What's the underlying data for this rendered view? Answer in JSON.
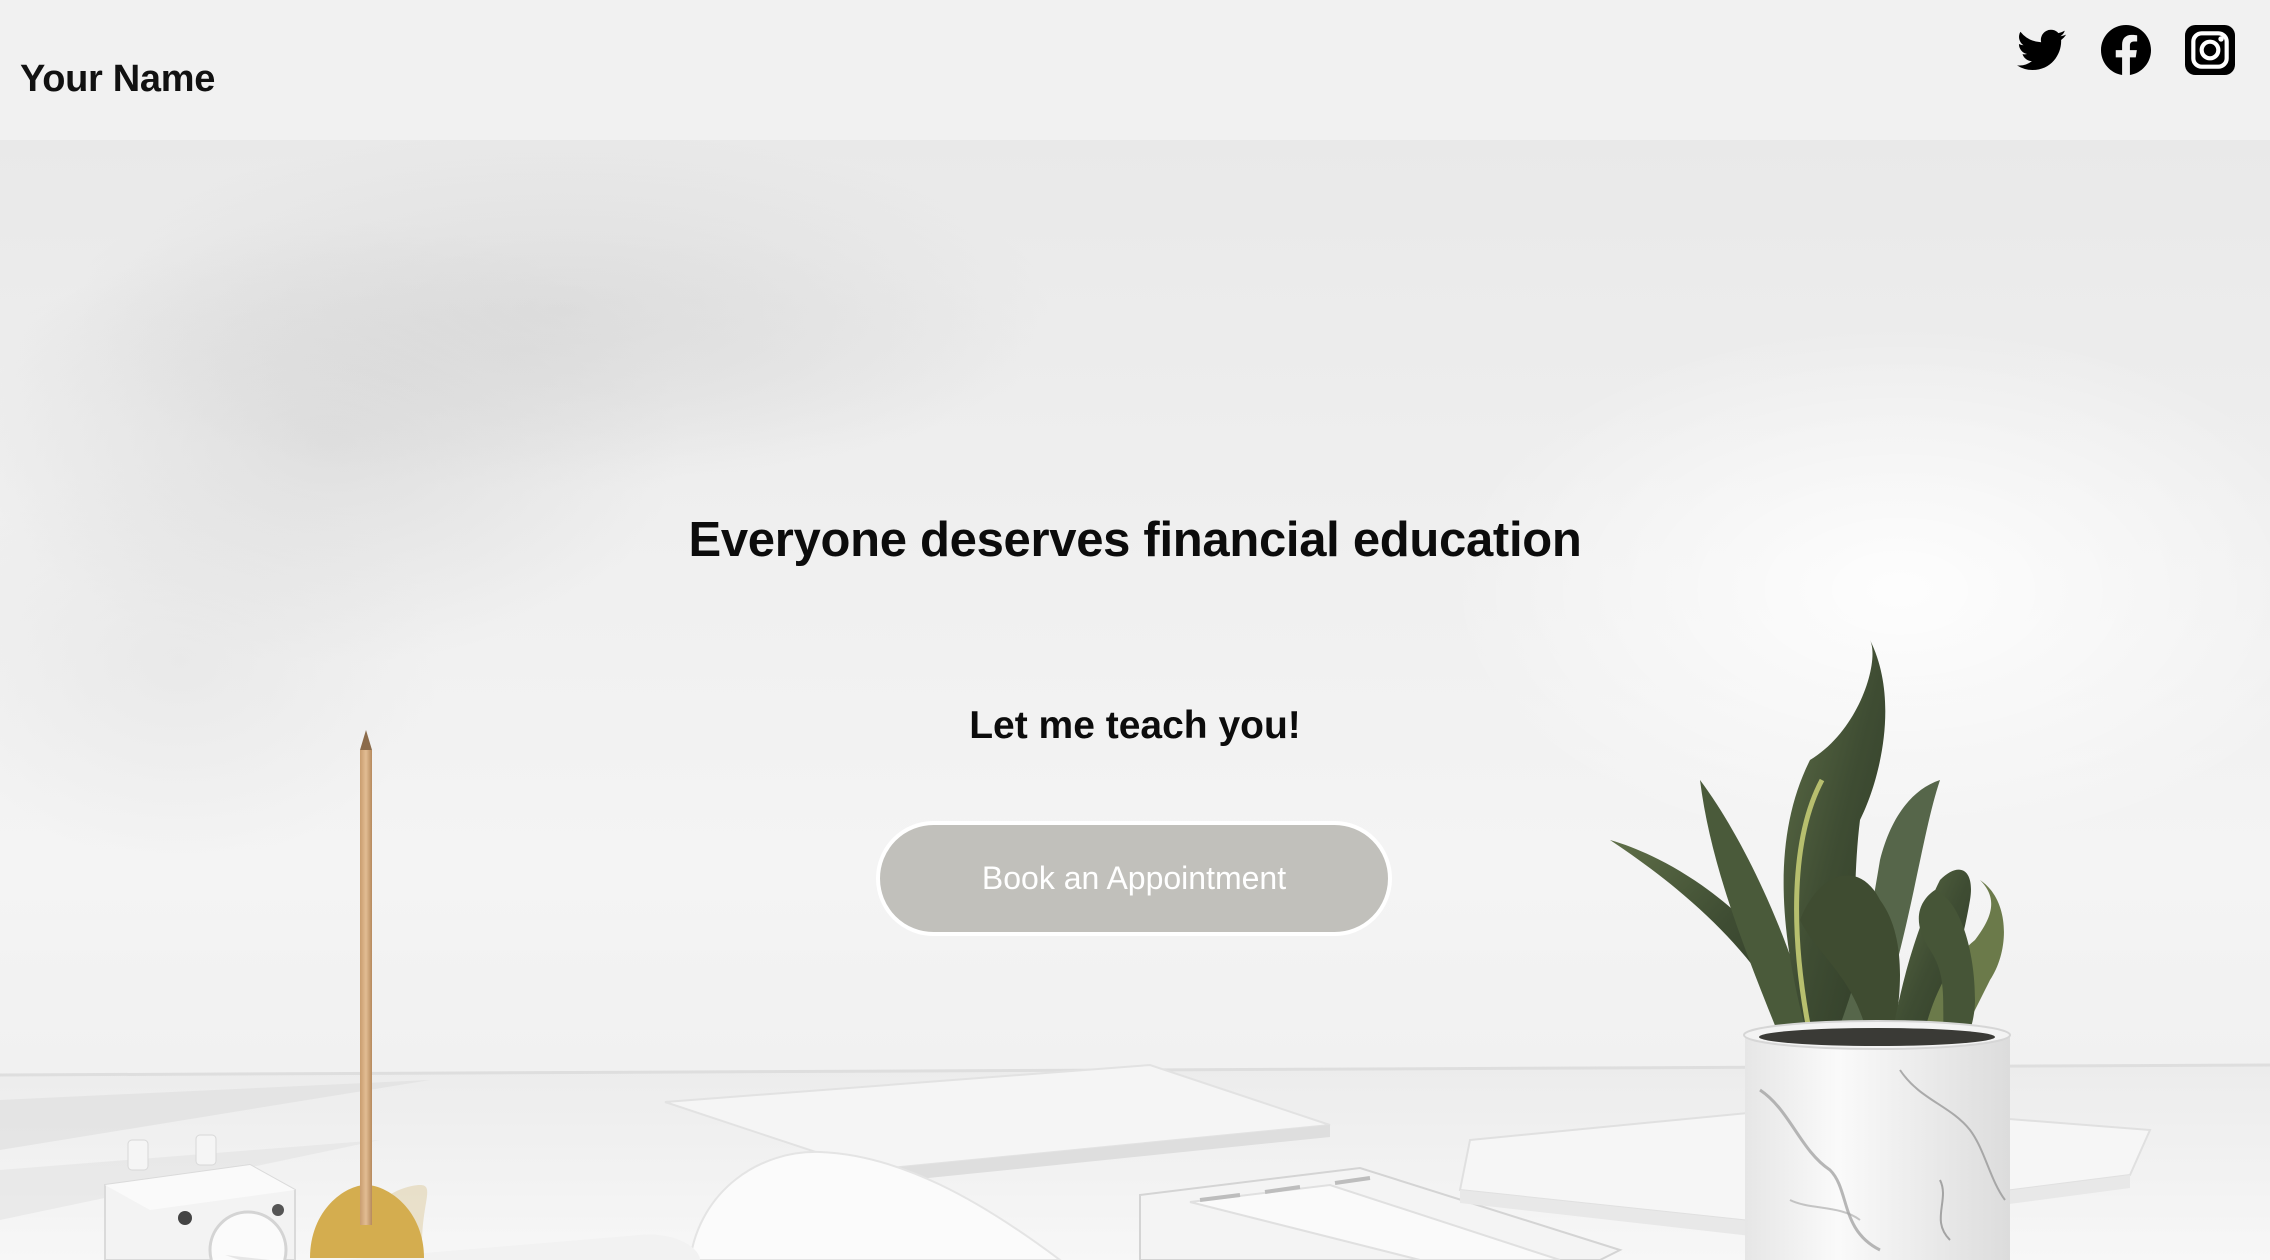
{
  "header": {
    "site_name": "Your Name",
    "social": [
      {
        "icon": "twitter-icon",
        "label": "Twitter"
      },
      {
        "icon": "facebook-icon",
        "label": "Facebook"
      },
      {
        "icon": "instagram-icon",
        "label": "Instagram"
      }
    ]
  },
  "hero": {
    "title": "Everyone deserves financial education",
    "subtitle": "Let me teach you!",
    "cta_label": "Book an Appointment"
  },
  "colors": {
    "background": "#f1f1f1",
    "text": "#111111",
    "button_fill": "#c1c0bb",
    "button_text": "#ffffff"
  }
}
